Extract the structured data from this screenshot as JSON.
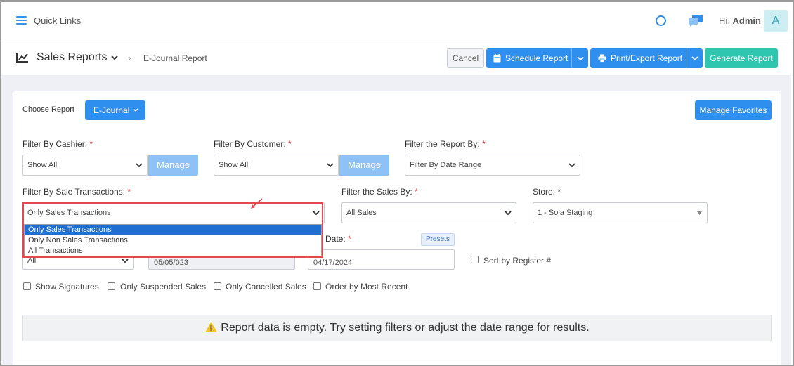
{
  "topbar": {
    "quick_links": "Quick Links",
    "greeting": "Hi,",
    "user_name": "Admin",
    "avatar_letter": "A"
  },
  "header": {
    "title": "Sales Reports",
    "breadcrumb_current": "E-Journal Report",
    "cancel": "Cancel",
    "schedule": "Schedule Report",
    "print_export": "Print/Export Report",
    "generate": "Generate Report"
  },
  "report": {
    "choose_label": "Choose Report",
    "choose_value": "E-Journal",
    "manage_favorites": "Manage Favorites"
  },
  "filters": {
    "cashier_label": "Filter By Cashier:",
    "cashier_value": "Show All",
    "customer_label": "Filter By Customer:",
    "customer_value": "Show All",
    "manage": "Manage",
    "report_by_label": "Filter the Report By:",
    "report_by_value": "Filter By Date Range",
    "sale_tx_label": "Filter By Sale Transactions:",
    "sale_tx_value": "Only Sales Transactions",
    "sale_tx_options": [
      "Only Sales Transactions",
      "Only Non Sales Transactions",
      "All Transactions"
    ],
    "sales_by_label": "Filter the Sales By:",
    "sales_by_value": "All Sales",
    "store_label": "Store:",
    "store_value": "1 - Sola Staging",
    "date_label": "Date:",
    "presets": "Presets",
    "small_select_value": "All",
    "start_date": "05/05/023",
    "end_date": "04/17/2024",
    "required_mark": "*"
  },
  "checkboxes": {
    "sort_by_register": "Sort by Register #",
    "show_signatures": "Show Signatures",
    "only_suspended": "Only Suspended Sales",
    "only_cancelled": "Only Cancelled Sales",
    "order_recent": "Order by Most Recent"
  },
  "message": {
    "empty": "Report data is empty. Try setting filters or adjust the date range for results."
  },
  "colors": {
    "primary": "#2f8fef",
    "teal": "#2fc6b0",
    "required": "#e0383a",
    "highlight": "#e5474f"
  }
}
